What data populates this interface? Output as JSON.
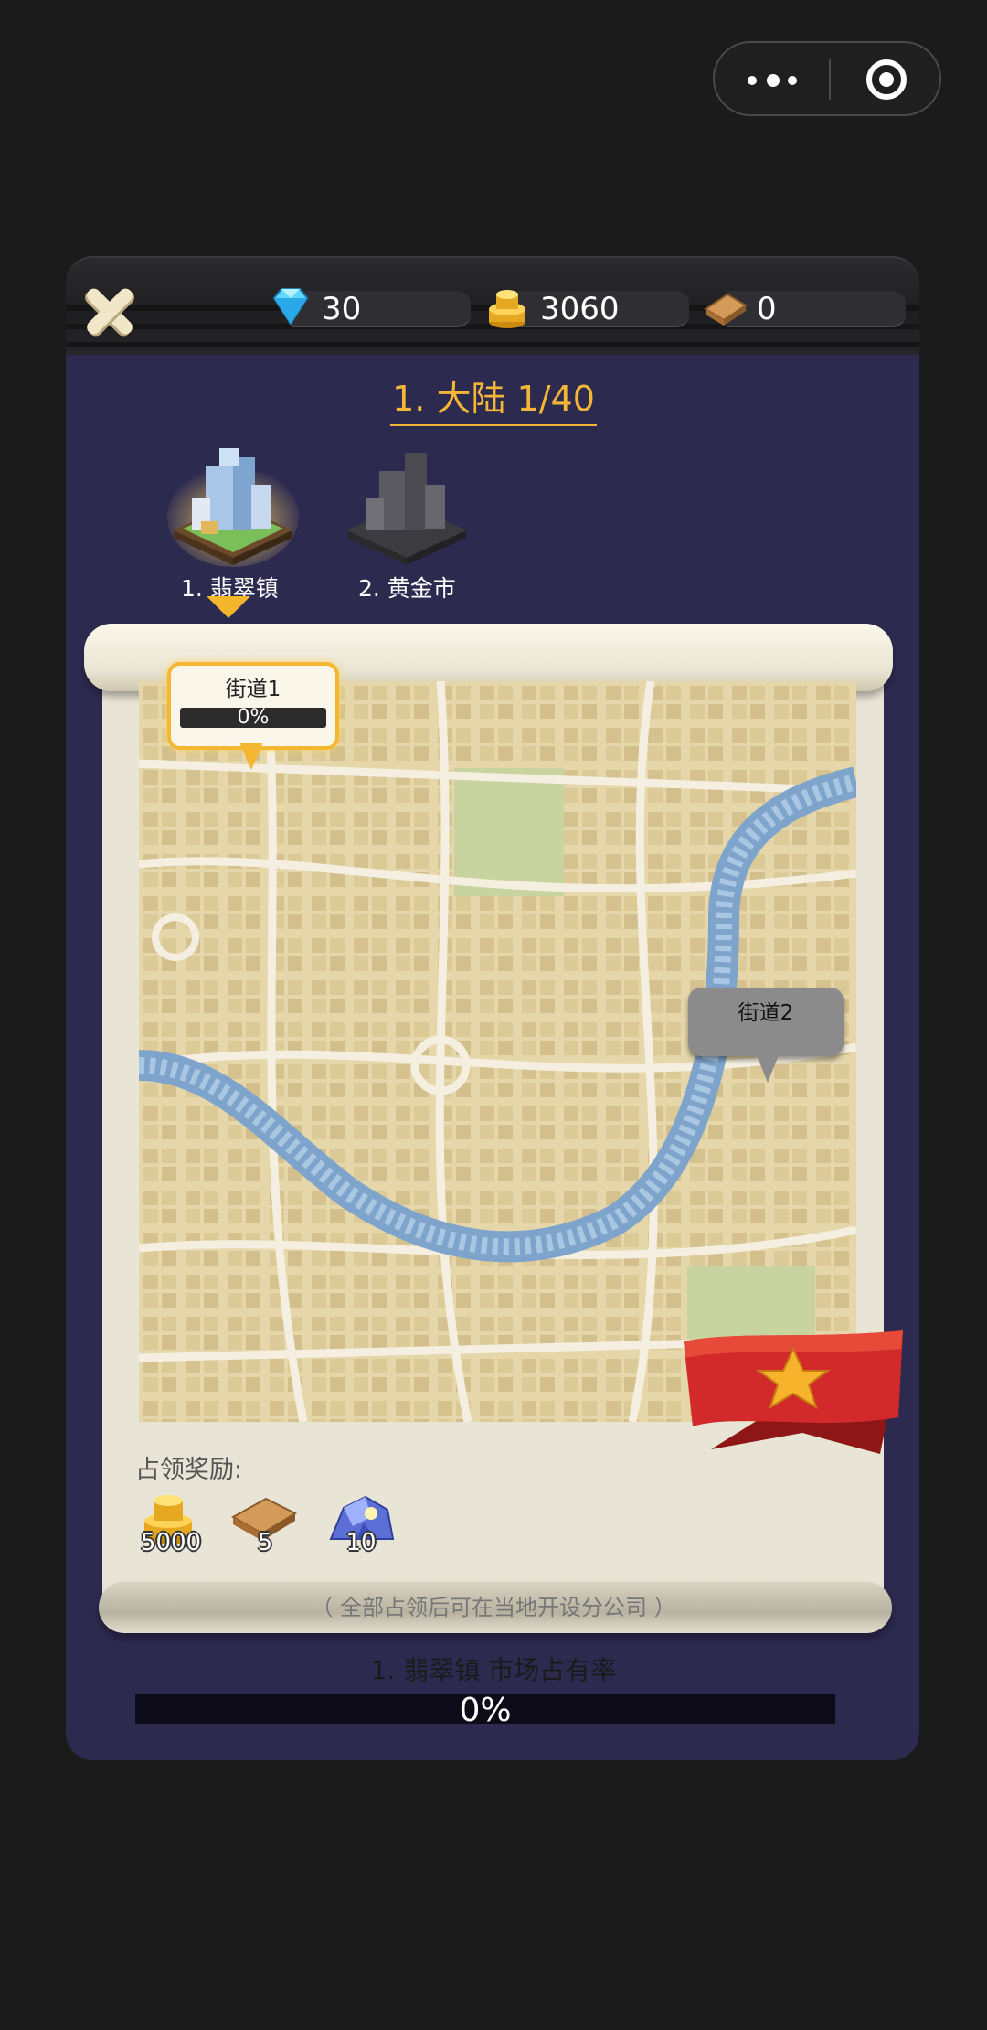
{
  "resources": {
    "diamonds": "30",
    "gold": "3060",
    "wood": "0"
  },
  "continent_title": "1. 大陆 1/40",
  "cities": [
    {
      "label": "1. 翡翠镇",
      "unlocked": true
    },
    {
      "label": "2. 黄金市",
      "unlocked": false
    }
  ],
  "streets": [
    {
      "label": "街道1",
      "progress_text": "0%",
      "progress": 0,
      "active": true
    },
    {
      "label": "街道2",
      "active": false
    }
  ],
  "rewards": {
    "title": "占领奖励:",
    "items": [
      {
        "icon": "gold-coins-icon",
        "value": "5000"
      },
      {
        "icon": "wood-planks-icon",
        "value": "5"
      },
      {
        "icon": "blue-gem-ore-icon",
        "value": "10"
      }
    ]
  },
  "note": "（ 全部占领后可在当地开设分公司 ）",
  "market": {
    "label": "1. 翡翠镇 市场占有率",
    "progress_text": "0%",
    "progress": 0
  },
  "colors": {
    "panel_bg": "#2d2a50",
    "accent_gold": "#f3b637",
    "background": "#1b1b1c"
  }
}
